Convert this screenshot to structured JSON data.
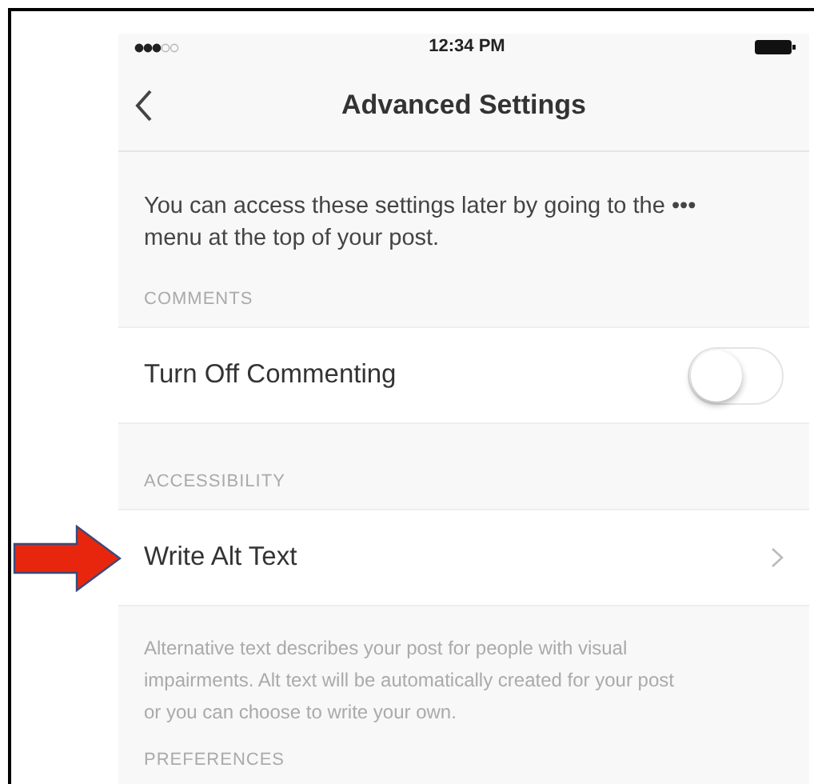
{
  "status_bar": {
    "time": "12:34 PM"
  },
  "nav": {
    "title": "Advanced Settings"
  },
  "intro": "You can access these settings later by going to the ••• menu at the top of your post.",
  "sections": [
    {
      "header": "COMMENTS",
      "rows": [
        {
          "kind": "toggle",
          "label": "Turn Off Commenting",
          "on": false,
          "pointer_arrow": false
        }
      ]
    },
    {
      "header": "ACCESSIBILITY",
      "rows": [
        {
          "kind": "link",
          "label": "Write Alt Text",
          "pointer_arrow": true
        }
      ],
      "footer": "Alternative text describes your post for people with visual impairments. Alt text will be automatically created for your post or you can choose to write your own."
    },
    {
      "header": "PREFERENCES"
    }
  ]
}
